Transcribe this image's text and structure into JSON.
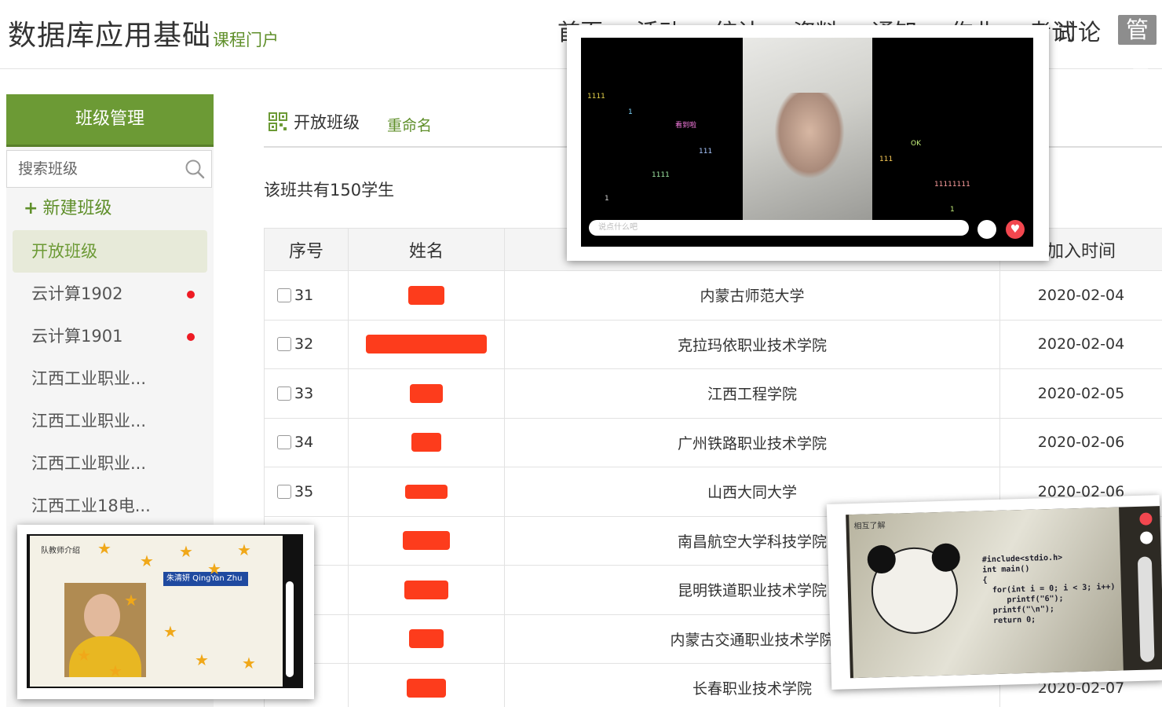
{
  "header": {
    "title": "数据库应用基础",
    "subtitle": "课程门户",
    "nav": [
      "首页",
      "活动",
      "统计",
      "资料",
      "通知",
      "作业",
      "考试"
    ],
    "nav_discuss": "讨论",
    "nav_manage": "管理"
  },
  "sidebar": {
    "heading": "班级管理",
    "search_placeholder": "搜索班级",
    "new_class": "新建班级",
    "items": [
      {
        "label": "开放班级",
        "active": true,
        "dot": false
      },
      {
        "label": "云计算1902",
        "active": false,
        "dot": true
      },
      {
        "label": "云计算1901",
        "active": false,
        "dot": true
      },
      {
        "label": "江西工业职业...",
        "active": false,
        "dot": false
      },
      {
        "label": "江西工业职业...",
        "active": false,
        "dot": false
      },
      {
        "label": "江西工业职业...",
        "active": false,
        "dot": false
      },
      {
        "label": "江西工业18电...",
        "active": false,
        "dot": false
      }
    ]
  },
  "main": {
    "tab_open": "开放班级",
    "tab_rename": "重命名",
    "count_text": "该班共有150学生",
    "columns": [
      "序号",
      "姓名",
      "",
      "加入时间"
    ],
    "rows": [
      {
        "num": "31",
        "school": "内蒙古师范大学",
        "date": "2020-02-04"
      },
      {
        "num": "32",
        "school": "克拉玛依职业技术学院",
        "date": "2020-02-04"
      },
      {
        "num": "33",
        "school": "江西工程学院",
        "date": "2020-02-05"
      },
      {
        "num": "34",
        "school": "广州铁路职业技术学院",
        "date": "2020-02-06"
      },
      {
        "num": "35",
        "school": "山西大同大学",
        "date": "2020-02-06"
      },
      {
        "num": "",
        "school": "南昌航空大学科技学院",
        "date": ""
      },
      {
        "num": "",
        "school": "昆明铁道职业技术学院",
        "date": ""
      },
      {
        "num": "",
        "school": "内蒙古交通职业技术学院",
        "date": ""
      },
      {
        "num": "",
        "school": "长春职业技术学院",
        "date": "2020-02-07"
      }
    ]
  },
  "overlay_top": {
    "input_placeholder": "说点什么吧",
    "danmaku": [
      "1111",
      "OK",
      "看到啦",
      "111",
      "11111111",
      "1"
    ]
  },
  "overlay_bottom_left": {
    "slide_title": "队教师介绍",
    "name_tag": "朱清妍 QingYan Zhu"
  },
  "overlay_bottom_right": {
    "tag": "相互了解",
    "code": "#include<stdio.h>\nint main()\n{\n  for(int i = 0; i < 3; i++)\n     printf(\"6\");\n  printf(\"\\n\");\n  return 0;"
  },
  "colors": {
    "brand_green": "#6c9a35",
    "redact_red": "#fd3c1c",
    "dot_red": "#ee1b24"
  }
}
